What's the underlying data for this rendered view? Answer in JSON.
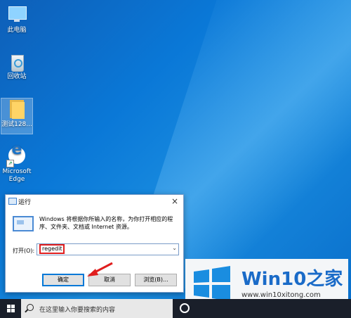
{
  "desktop": {
    "icons": [
      {
        "label": "此电脑"
      },
      {
        "label": "回收站"
      },
      {
        "label": "测试128..."
      },
      {
        "label": "Microsoft Edge"
      }
    ]
  },
  "run_dialog": {
    "title": "运行",
    "close_glyph": "×",
    "description": "Windows 将根据你所输入的名称，为你打开相应的程序、文件夹、文档或 Internet 资源。",
    "open_label": "打开(O):",
    "open_value": "regedit",
    "dropdown_glyph": "⌄",
    "ok_label": "确定",
    "cancel_label": "取消",
    "browse_label": "浏览(B)..."
  },
  "taskbar": {
    "search_placeholder": "在这里输入你要搜索的内容"
  },
  "watermark": {
    "title_a": "Win10",
    "title_b": "之家",
    "url": "www.win10xitong.com"
  },
  "colors": {
    "desktop_blue": "#0a78d7",
    "taskbar": "#1a1f2a",
    "highlight_red": "#e01e1e",
    "watermark_blue": "#1a6bc8"
  }
}
